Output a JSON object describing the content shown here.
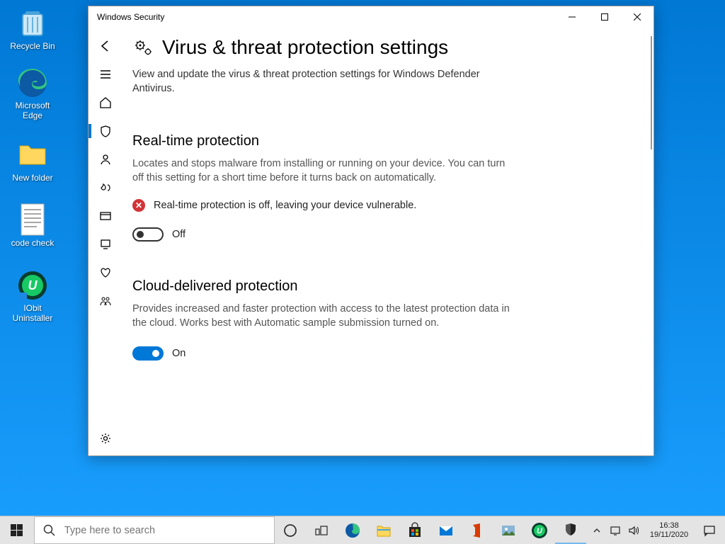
{
  "desktop": {
    "icons": [
      {
        "label": "Recycle Bin"
      },
      {
        "label": "Microsoft Edge"
      },
      {
        "label": "New folder"
      },
      {
        "label": "code check"
      },
      {
        "label": "IObit Uninstaller"
      }
    ]
  },
  "window": {
    "title": "Windows Security",
    "page": {
      "title": "Virus & threat protection settings",
      "subtitle": "View and update the virus & threat protection settings for Windows Defender Antivirus."
    },
    "sections": {
      "realtime": {
        "heading": "Real-time protection",
        "desc": "Locates and stops malware from installing or running on your device. You can turn off this setting for a short time before it turns back on automatically.",
        "warning": "Real-time protection is off, leaving your device vulnerable.",
        "toggle_state": "Off"
      },
      "cloud": {
        "heading": "Cloud-delivered protection",
        "desc": "Provides increased and faster protection with access to the latest protection data in the cloud. Works best with Automatic sample submission turned on.",
        "toggle_state": "On"
      }
    }
  },
  "taskbar": {
    "search_placeholder": "Type here to search",
    "clock_time": "16:38",
    "clock_date": "19/11/2020"
  }
}
